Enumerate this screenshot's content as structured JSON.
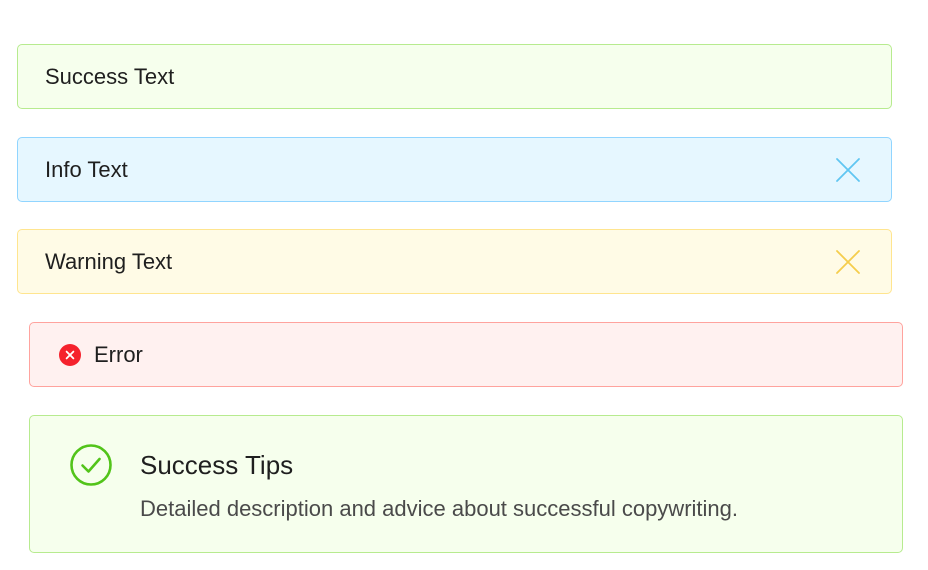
{
  "alerts": {
    "success": {
      "message": "Success Text",
      "closable": false,
      "color": "#b7eb8f"
    },
    "info": {
      "message": "Info Text",
      "closable": true,
      "close_icon": "close-icon",
      "color": "#5fc6f2"
    },
    "warning": {
      "message": "Warning Text",
      "closable": true,
      "close_icon": "close-icon",
      "color": "#f5cd4c"
    },
    "error": {
      "message": "Error",
      "icon": "close-circle-filled-icon",
      "color": "#f5222d"
    },
    "success_tips": {
      "title": "Success Tips",
      "description": "Detailed description and advice about successful copywriting.",
      "icon": "check-circle-outline-icon",
      "color": "#52c41a"
    }
  }
}
